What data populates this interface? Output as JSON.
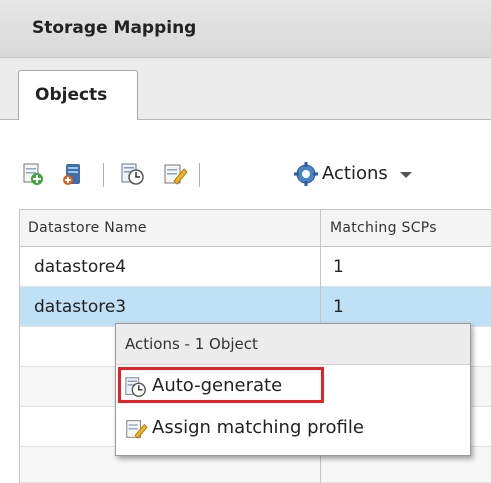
{
  "panel": {
    "title": "Storage Mapping"
  },
  "tabs": [
    {
      "label": "Objects",
      "active": true
    }
  ],
  "toolbar": {
    "icons": [
      "add-object-icon",
      "add-datastore-icon",
      "auto-generate-icon",
      "assign-profile-icon"
    ],
    "actions_label": "Actions"
  },
  "grid": {
    "columns": [
      "Datastore Name",
      "Matching SCPs"
    ],
    "rows": [
      {
        "name": "datastore4",
        "matching": "1"
      },
      {
        "name": "datastore3",
        "matching": "1",
        "selected": true
      }
    ]
  },
  "context_menu": {
    "header": "Actions - 1 Object",
    "items": [
      {
        "label": "Auto-generate",
        "icon": "auto-generate-icon",
        "highlighted": true
      },
      {
        "label": "Assign matching profile",
        "icon": "assign-profile-icon"
      }
    ]
  },
  "colors": {
    "selection": "#bfe0f5",
    "highlight_border": "#e8202a"
  }
}
